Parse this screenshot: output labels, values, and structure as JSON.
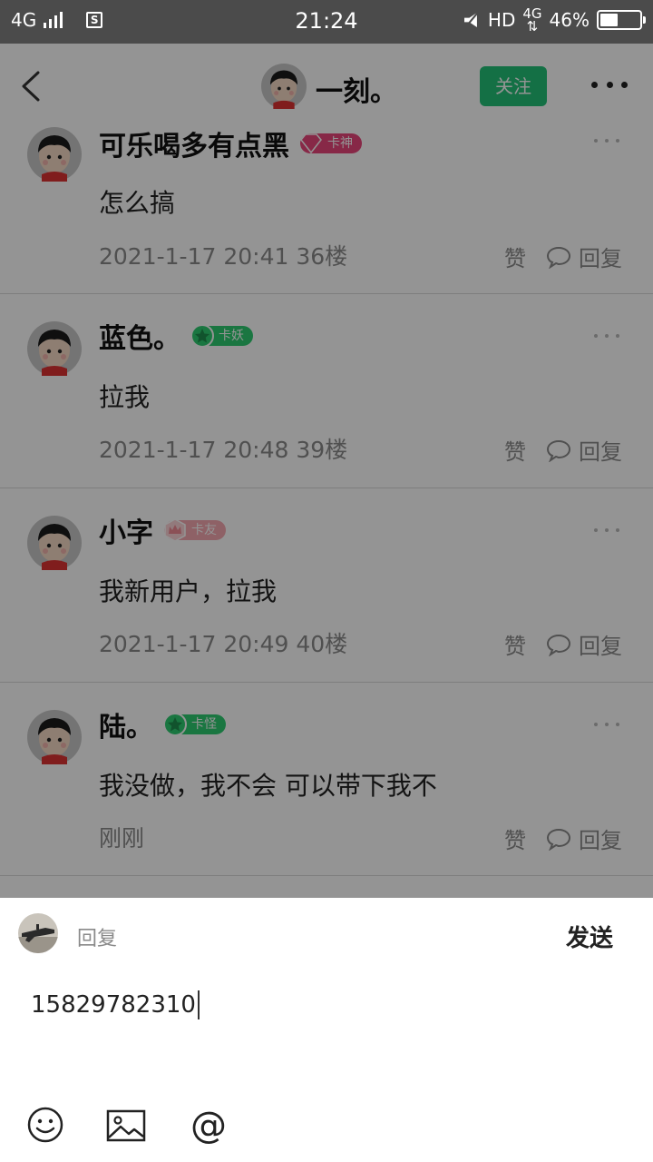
{
  "status_bar": {
    "network_left": "4G",
    "time": "21:24",
    "hd": "HD",
    "network_right": "4G",
    "battery_percent": "46%",
    "battery_level": 0.46,
    "sim_label": "S"
  },
  "header": {
    "title": "一刻。",
    "follow_label": "关注"
  },
  "comments": [
    {
      "name": "可乐喝多有点黑",
      "badge": "卡神",
      "badge_color": "#e8457a",
      "text": "怎么搞",
      "meta": "2021-1-17 20:41  36楼",
      "like": "赞",
      "reply": "回复"
    },
    {
      "name": "蓝色。",
      "badge": "卡妖",
      "badge_color": "#2ecc71",
      "text": "拉我",
      "meta": "2021-1-17 20:48  39楼",
      "like": "赞",
      "reply": "回复"
    },
    {
      "name": "小字",
      "badge": "卡友",
      "badge_color": "#f5a8b0",
      "text": "我新用户，拉我",
      "meta": "2021-1-17 20:49  40楼",
      "like": "赞",
      "reply": "回复"
    },
    {
      "name": "陆。",
      "badge": "卡怪",
      "badge_color": "#2ecc71",
      "text": "我没做，我不会  可以带下我不",
      "meta": "刚刚",
      "like": "赞",
      "reply": "回复"
    }
  ],
  "reply_panel": {
    "label": "回复",
    "send_label": "发送",
    "input_value": "15829782310"
  },
  "toolbar": {
    "emoji_icon": "smiley-icon",
    "image_icon": "image-icon",
    "mention_icon": "at-icon"
  }
}
